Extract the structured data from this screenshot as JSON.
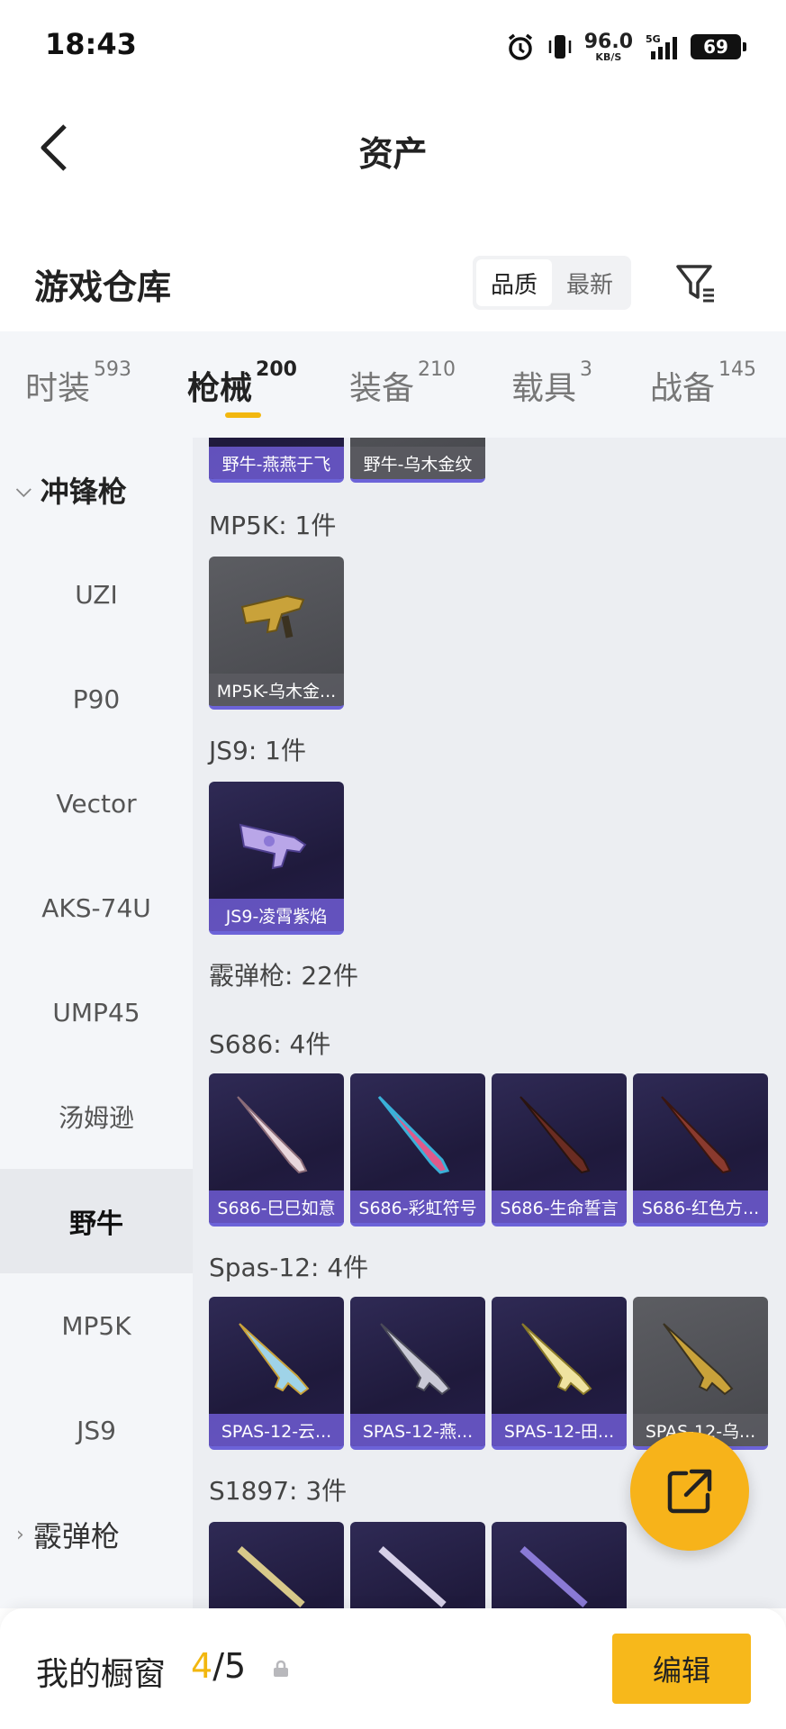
{
  "status_bar": {
    "time": "18:43",
    "net_speed": "96.0",
    "net_unit": "KB/S",
    "signal": "5G",
    "battery": "69"
  },
  "header": {
    "title": "资产"
  },
  "warehouse": {
    "title": "游戏仓库",
    "sort_options": [
      "品质",
      "最新"
    ],
    "sort_selected": "品质"
  },
  "tabs": [
    {
      "label": "时装",
      "count": "593"
    },
    {
      "label": "枪械",
      "count": "200"
    },
    {
      "label": "装备",
      "count": "210"
    },
    {
      "label": "载具",
      "count": "3"
    },
    {
      "label": "战备",
      "count": "145"
    }
  ],
  "sidebar": {
    "group": "冲锋枪",
    "items": [
      "UZI",
      "P90",
      "Vector",
      "AKS-74U",
      "UMP45",
      "汤姆逊",
      "野牛",
      "MP5K",
      "JS9"
    ],
    "active": "野牛",
    "collapsed_group": "霰弹枪"
  },
  "content": {
    "top_cards": [
      "野牛-燕燕于飞",
      "野牛-乌木金纹"
    ],
    "mp5k": {
      "label": "MP5K: 1件",
      "cards": [
        "MP5K-乌木金..."
      ]
    },
    "js9": {
      "label": "JS9: 1件",
      "cards": [
        "JS9-凌霄紫焰"
      ]
    },
    "shotgun_header": "霰弹枪: 22件",
    "s686": {
      "label": "S686: 4件",
      "cards": [
        "S686-巳巳如意",
        "S686-彩虹符号",
        "S686-生命誓言",
        "S686-红色方..."
      ]
    },
    "spas12": {
      "label": "Spas-12: 4件",
      "cards": [
        "SPAS-12-云...",
        "SPAS-12-燕...",
        "SPAS-12-田...",
        "SPAS-12-乌..."
      ]
    },
    "s1897": {
      "label": "S1897: 3件"
    }
  },
  "bottom": {
    "label": "我的橱窗",
    "count_current": "4",
    "count_total": "/5",
    "edit": "编辑"
  },
  "colors": {
    "accent": "#f2b70f",
    "card_purple": "#6c63d8"
  }
}
